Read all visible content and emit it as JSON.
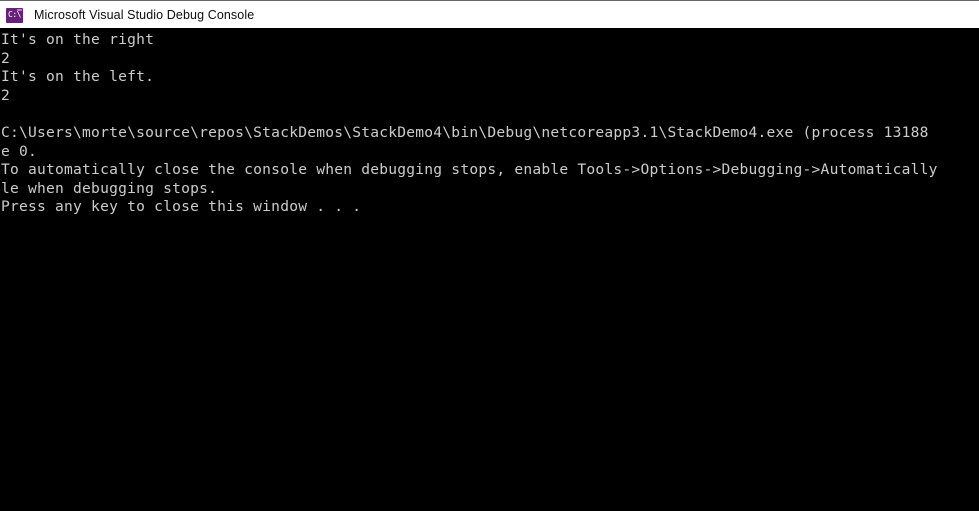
{
  "window": {
    "title": "Microsoft Visual Studio Debug Console",
    "icon": "console-cmd-icon",
    "icon_glyph": "C:\\",
    "titlebar_bg": "#ffffff",
    "titlebar_text_color": "#0d0d0d",
    "icon_color": "#68217a",
    "console_bg": "#000000",
    "console_text_color": "#cccccc"
  },
  "console": {
    "lines": [
      "It's on the right",
      "2",
      "It's on the left.",
      "2",
      "",
      "C:\\Users\\morte\\source\\repos\\StackDemos\\StackDemo4\\bin\\Debug\\netcoreapp3.1\\StackDemo4.exe (process 13188",
      "e 0.",
      "To automatically close the console when debugging stops, enable Tools->Options->Debugging->Automatically",
      "le when debugging stops.",
      "Press any key to close this window . . ."
    ]
  }
}
